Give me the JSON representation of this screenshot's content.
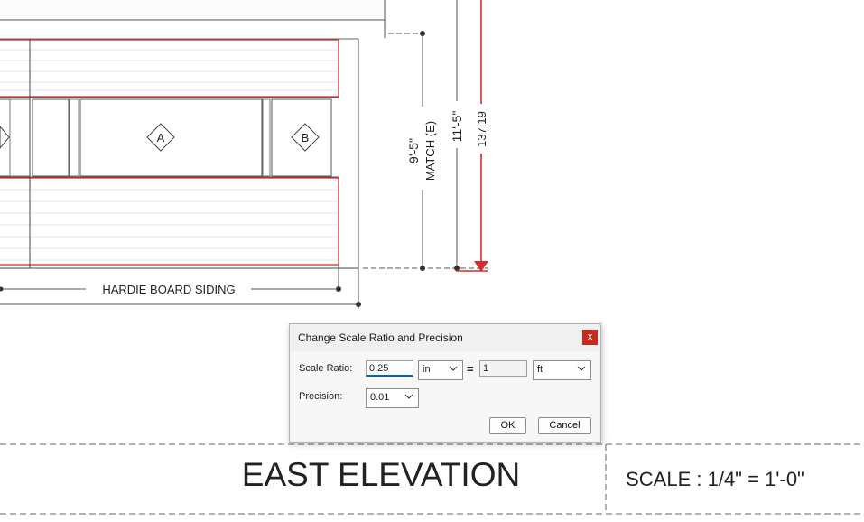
{
  "drawing": {
    "tag_a": "A",
    "tag_b": "B",
    "material_label": "HARDIE BOARD SIDING",
    "dim_match_value": "9'-5\"",
    "dim_match_note": "MATCH (E)",
    "dim_overall": "11'-5\"",
    "dim_measure": "137.19",
    "view_title": "EAST ELEVATION",
    "view_scale": "SCALE : 1/4\" = 1'-0\"",
    "accent_color": "#d32f2f"
  },
  "dialog": {
    "title": "Change Scale Ratio and Precision",
    "close_label": "x",
    "scale_ratio_label": "Scale Ratio:",
    "scale_value": "0.25",
    "scale_unit": "in",
    "equals": "=",
    "target_value": "1",
    "target_unit": "ft",
    "precision_label": "Precision:",
    "precision_value": "0.01",
    "ok_label": "OK",
    "cancel_label": "Cancel"
  }
}
